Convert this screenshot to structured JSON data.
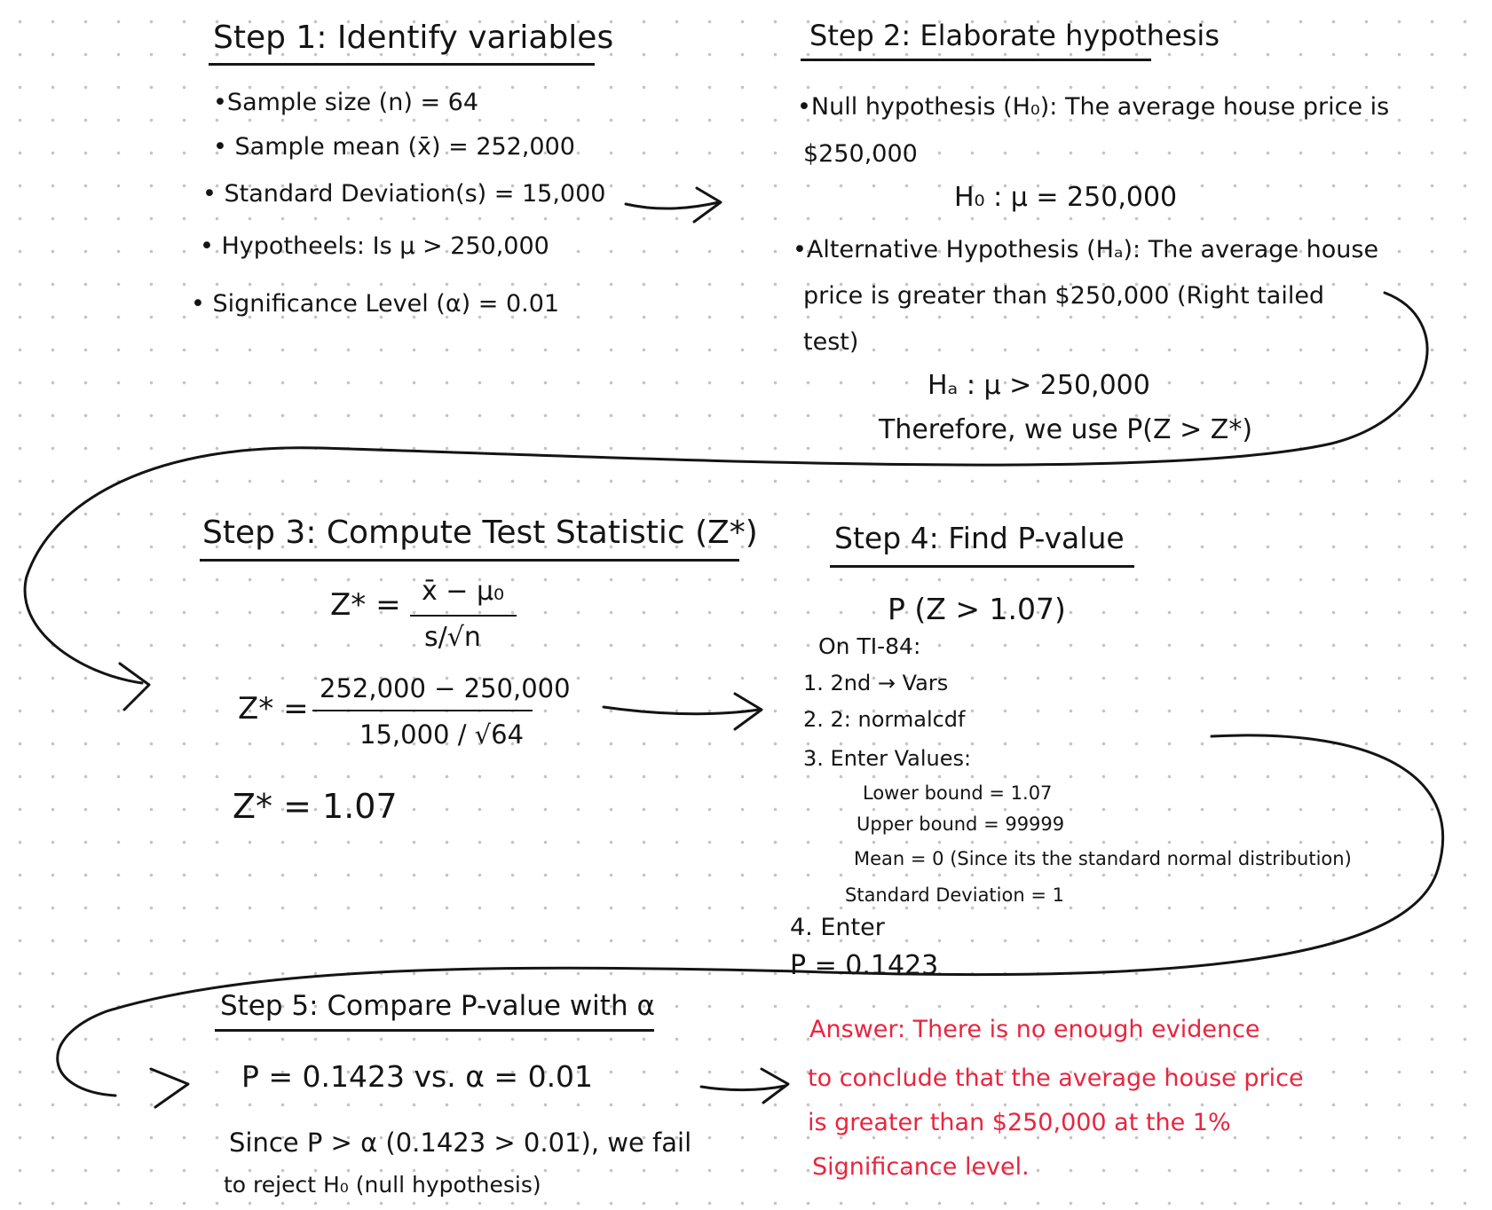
{
  "step1": {
    "heading": "Step 1: Identify variables",
    "bullets": [
      "•Sample size (n) = 64",
      "• Sample mean (x̄) = 252,000",
      "• Standard Deviation(s) = 15,000",
      "• Hypotheels: Is μ > 250,000",
      "• Significance Level (α) = 0.01"
    ]
  },
  "step2": {
    "heading": "Step 2: Elaborate hypothesis",
    "null_line1": "•Null hypothesis (H₀): The average house price is",
    "null_line2": "$250,000",
    "null_formula": "H₀ : μ = 250,000",
    "alt_line1": "•Alternative Hypothesis (Hₐ): The average house",
    "alt_line2": "price is greater than $250,000 (Right tailed",
    "alt_line3": "test)",
    "alt_formula": "Hₐ : μ > 250,000",
    "therefore": "Therefore, we use P(Z > Z*)"
  },
  "step3": {
    "heading": "Step 3: Compute Test Statistic (Z*)",
    "formula_lhs": "Z* =",
    "formula_num": "x̄ − μ₀",
    "formula_den": "s/√n",
    "sub_lhs": "Z* =",
    "sub_num": "252,000 − 250,000",
    "sub_den": "15,000 / √64",
    "result": "Z* = 1.07"
  },
  "step4": {
    "heading": "Step 4: Find P-value",
    "prob": "P (Z > 1.07)",
    "calc_title": "On TI-84:",
    "steps": [
      "1. 2nd → Vars",
      "2. 2: normalcdf",
      "3. Enter Values:"
    ],
    "values": [
      "Lower bound = 1.07",
      "Upper bound = 99999",
      "Mean = 0 (Since its the standard normal distribution)",
      "Standard Deviation = 1"
    ],
    "step_enter": "4. Enter",
    "p_result": "P = 0.1423"
  },
  "step5": {
    "heading": "Step 5: Compare P-value with α",
    "comparison": "P = 0.1423   vs.   α = 0.01",
    "conclusion_line1": "Since P > α (0.1423 > 0.01), we fail",
    "conclusion_line2": "to reject H₀ (null hypothesis)"
  },
  "answer": {
    "line1": "Answer: There is no enough evidence",
    "line2": "to conclude that the average house price",
    "line3": "is greater than $250,000 at the 1%",
    "line4": "Significance level."
  },
  "colors": {
    "ink": "#141414",
    "answer": "#e8253f",
    "grid_dots": "#c4c4c4"
  }
}
